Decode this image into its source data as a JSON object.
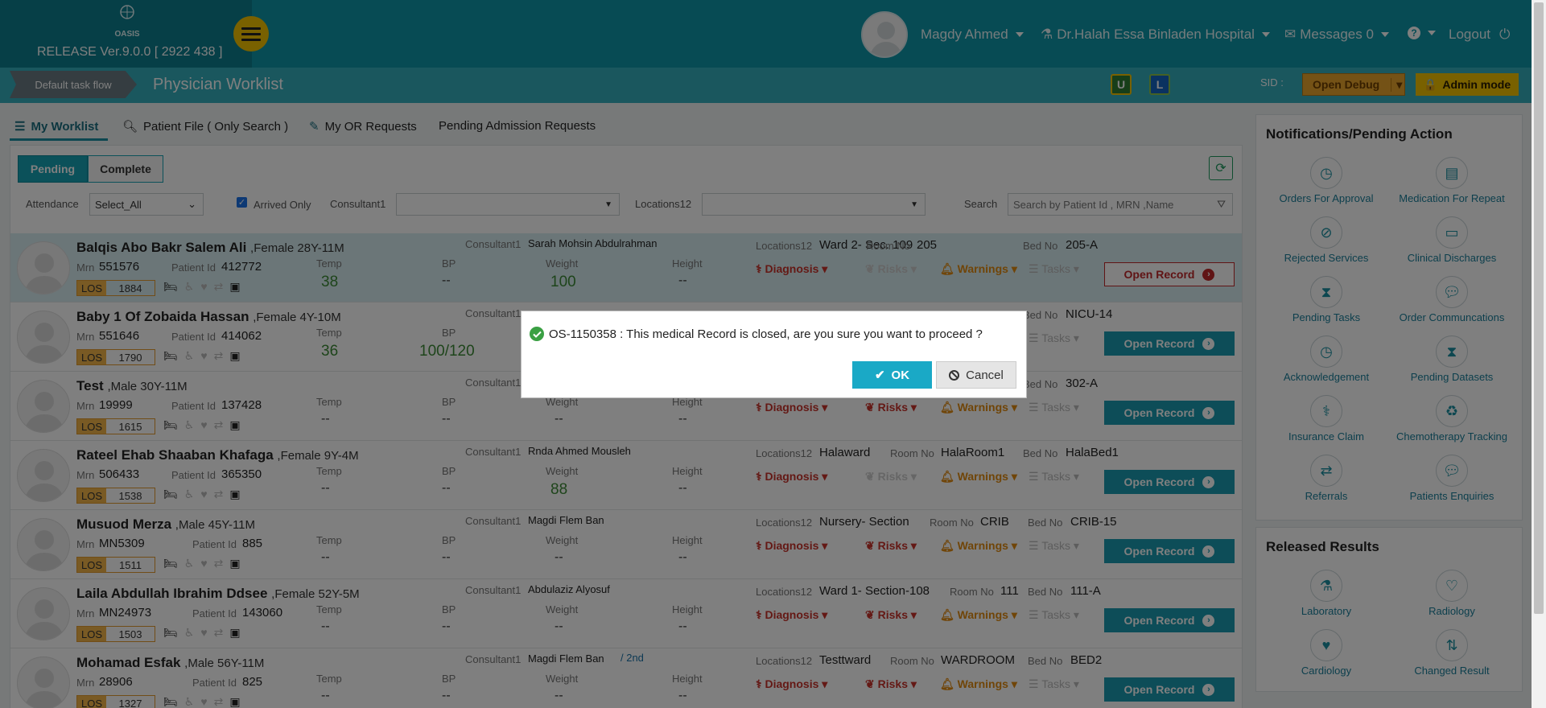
{
  "header": {
    "release": "RELEASE Ver.9.0.0 [ 2922 438 ]",
    "logo_text": "OASIS",
    "user": "Magdy Ahmed",
    "hospital": "Dr.Halah Essa Binladen Hospital",
    "messages": "Messages 0",
    "logout": "Logout"
  },
  "subbar": {
    "taskflow": "Default task flow",
    "title": "Physician Worklist",
    "sid": "SID :",
    "open_debug": "Open Debug",
    "admin_mode": "Admin mode",
    "icon_u": "U",
    "icon_l": "L"
  },
  "tabs": [
    {
      "label": "My Worklist"
    },
    {
      "label": "Patient File ( Only Search )"
    },
    {
      "label": "My OR Requests"
    },
    {
      "label": "Pending Admission Requests"
    }
  ],
  "filters": {
    "pending": "Pending",
    "complete": "Complete",
    "attendance_label": "Attendance",
    "attendance_value": "Select_All",
    "arrived_only": "Arrived Only",
    "consultant_label": "Consultant1",
    "locations_label": "Locations12",
    "search_label": "Search",
    "search_placeholder": "Search by Patient Id , MRN ,Name"
  },
  "labels": {
    "mrn": "Mrn",
    "patient_id": "Patient Id",
    "temp": "Temp",
    "bp": "BP",
    "weight": "Weight",
    "height": "Height",
    "consultant": "Consultant1",
    "locations": "Locations12",
    "room": "Room No",
    "bed": "Bed No",
    "los": "LOS",
    "diagnosis": "Diagnosis",
    "risks": "Risks",
    "warnings": "Warnings",
    "tasks": "Tasks",
    "open_record": "Open Record",
    "dash": "--"
  },
  "patients": [
    {
      "name": "Balqis Abo Bakr Salem Ali",
      "info": ",Female 28Y-11M",
      "mrn": "551576",
      "pid": "412772",
      "temp": "38",
      "bp": "--",
      "weight": "100",
      "height": "--",
      "consultant": "Sarah Mohsin Abdulrahman",
      "location": "Ward 2- Sec. 109",
      "room": "205",
      "bed": "205-A",
      "los": "1884"
    },
    {
      "name": "Baby 1 Of Zobaida Hassan",
      "info": ",Female 4Y-10M",
      "mrn": "551646",
      "pid": "414062",
      "temp": "36",
      "bp": "100/120",
      "weight": "",
      "height": "",
      "consultant": "",
      "location": "",
      "room": "",
      "bed": "NICU-14",
      "los": "1790"
    },
    {
      "name": "Test",
      "info": ",Male 30Y-11M",
      "mrn": "19999",
      "pid": "137428",
      "temp": "--",
      "bp": "--",
      "weight": "--",
      "height": "--",
      "consultant": "",
      "location": "",
      "room": "",
      "bed": "302-A",
      "los": "1615"
    },
    {
      "name": "Rateel Ehab Shaaban Khafaga",
      "info": ",Female 9Y-4M",
      "mrn": "506433",
      "pid": "365350",
      "temp": "--",
      "bp": "--",
      "weight": "88",
      "height": "--",
      "consultant": "Rnda Ahmed Mousleh",
      "location": "Halaward",
      "room": "HalaRoom1",
      "bed": "HalaBed1",
      "los": "1538"
    },
    {
      "name": "Musuod Merza",
      "info": ",Male 45Y-11M",
      "mrn": "MN5309",
      "pid": "885",
      "temp": "--",
      "bp": "--",
      "weight": "--",
      "height": "--",
      "consultant": "Magdi Flem Ban",
      "location": "Nursery- Section",
      "room": "CRIB",
      "bed": "CRIB-15",
      "los": "1511"
    },
    {
      "name": "Laila Abdullah Ibrahim Ddsee",
      "info": ",Female 52Y-5M",
      "mrn": "MN24973",
      "pid": "143060",
      "temp": "--",
      "bp": "--",
      "weight": "--",
      "height": "--",
      "consultant": "Abdulaziz Alyosuf",
      "location": "Ward 1- Section-108",
      "room": "111",
      "bed": "111-A",
      "los": "1503"
    },
    {
      "name": "Mohamad Esfak",
      "info": ",Male 56Y-11M",
      "mrn": "28906",
      "pid": "825",
      "temp": "--",
      "bp": "--",
      "weight": "--",
      "height": "--",
      "consultant": "Magdi Flem Ban",
      "consultant_suffix": "/ 2nd",
      "location": "Testtward",
      "room": "WARDROOM",
      "bed": "BED2",
      "los": "1327"
    }
  ],
  "notifications": {
    "title": "Notifications/Pending Action",
    "items": [
      "Orders For Approval",
      "Medication For Repeat",
      "Rejected Services",
      "Clinical Discharges",
      "Pending Tasks",
      "Order Communcations",
      "Acknowledgement",
      "Pending Datasets",
      "Insurance Claim",
      "Chemotherapy Tracking",
      "Referrals",
      "Patients Enquiries"
    ]
  },
  "released": {
    "title": "Released Results",
    "items": [
      "Laboratory",
      "Radiology",
      "Cardiology",
      "Changed Result"
    ]
  },
  "dialog": {
    "message": "OS-1150358 : This medical Record is closed, are you sure you want to proceed ?",
    "ok": "OK",
    "cancel": "Cancel"
  },
  "colors": {
    "header": "#0e97a8",
    "accent": "#1a9bb0",
    "admin": "#f2c200",
    "danger": "#c8332b"
  }
}
